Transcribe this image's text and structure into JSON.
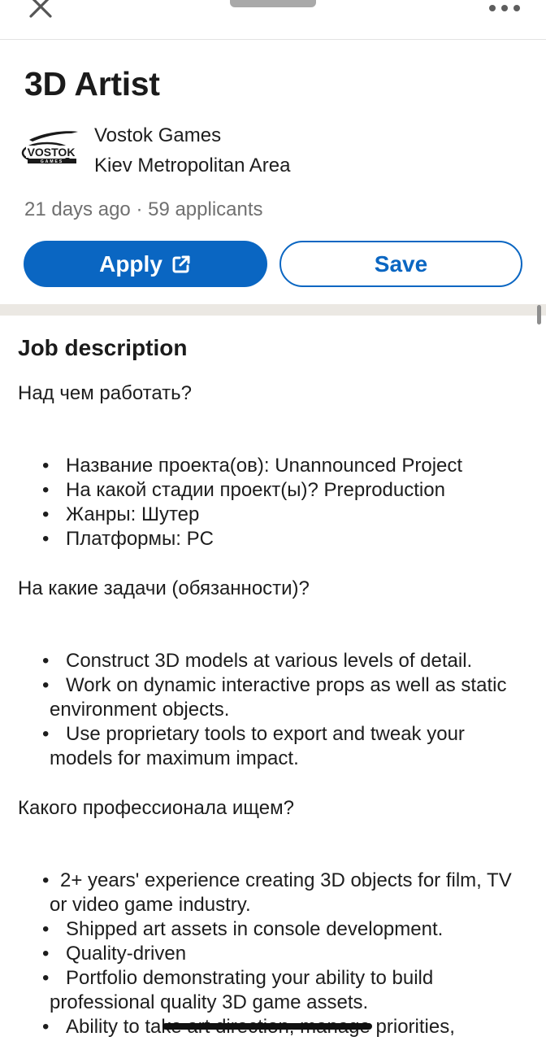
{
  "topbar": {
    "close_icon": "close-icon",
    "more_icon": "more-horizontal-icon"
  },
  "job": {
    "title": "3D Artist",
    "company": "Vostok Games",
    "location": "Kiev Metropolitan Area",
    "meta": "21 days ago · 59 applicants",
    "logo_text": "VOSTOK",
    "logo_subtext": "GAMES"
  },
  "actions": {
    "apply_label": "Apply",
    "save_label": "Save",
    "apply_color": "#0a66c2"
  },
  "description": {
    "heading": "Job description",
    "sections": [
      {
        "question": "Над чем работать?",
        "items": [
          "Название проекта(ов): Unannounced Project",
          "На какой стадии проект(ы)? Preproduction",
          "Жанры: Шутер",
          "Платформы: PC"
        ]
      },
      {
        "question": "На какие задачи (обязанности)?",
        "items": [
          "Construct 3D models at various levels of detail.",
          "Work on dynamic interactive props as well as static environment objects.",
          "Use proprietary tools to export and tweak your models for maximum impact."
        ]
      },
      {
        "question": "Какого профессионала ищем?",
        "items": [
          "2+ years' experience creating 3D objects for film, TV or video game industry.",
          "Shipped art assets in console development.",
          "Quality-driven",
          "Portfolio demonstrating your ability to build professional quality 3D game assets.",
          "Ability to take art direction, manage priorities,"
        ]
      }
    ]
  }
}
